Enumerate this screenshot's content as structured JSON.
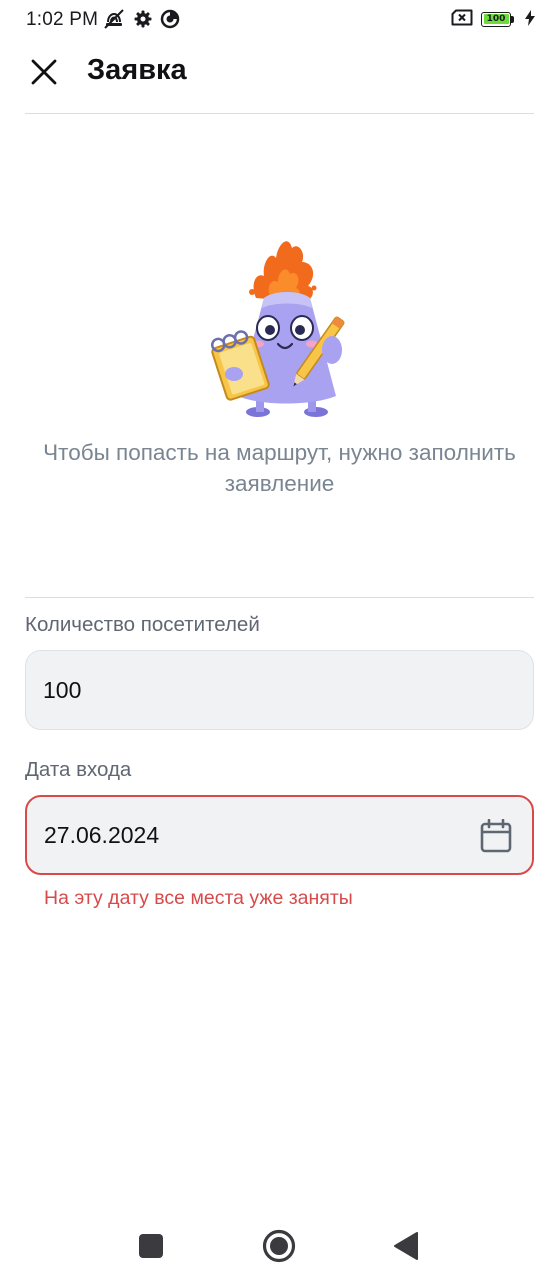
{
  "status_bar": {
    "time": "1:02 PM",
    "battery_level": "100",
    "icons_left": [
      "wifi-calling-off-icon",
      "settings-gear-icon",
      "data-saver-icon"
    ],
    "icons_right": [
      "sim-off-icon",
      "battery-icon",
      "charging-bolt-icon"
    ]
  },
  "app_bar": {
    "title": "Заявка",
    "close_icon": "close-icon"
  },
  "hero": {
    "illustration": "volcano-mascot-with-notebook",
    "text": "Чтобы попасть на маршрут, нужно заполнить заявление"
  },
  "form": {
    "visitors": {
      "label": "Количество посетителей",
      "value": "100"
    },
    "date": {
      "label": "Дата входа",
      "value": "27.06.2024",
      "icon": "calendar-icon",
      "error": "На эту дату все места уже заняты"
    }
  },
  "colors": {
    "error": "#d84a4a",
    "field_bg": "#f1f2f4",
    "secondary_text": "#7a8592",
    "mascot_body": "#a8a2f0",
    "mascot_flame": "#f26a1b"
  },
  "nav_bar": {
    "buttons": [
      "recents-square-icon",
      "home-circle-icon",
      "back-triangle-icon"
    ]
  }
}
